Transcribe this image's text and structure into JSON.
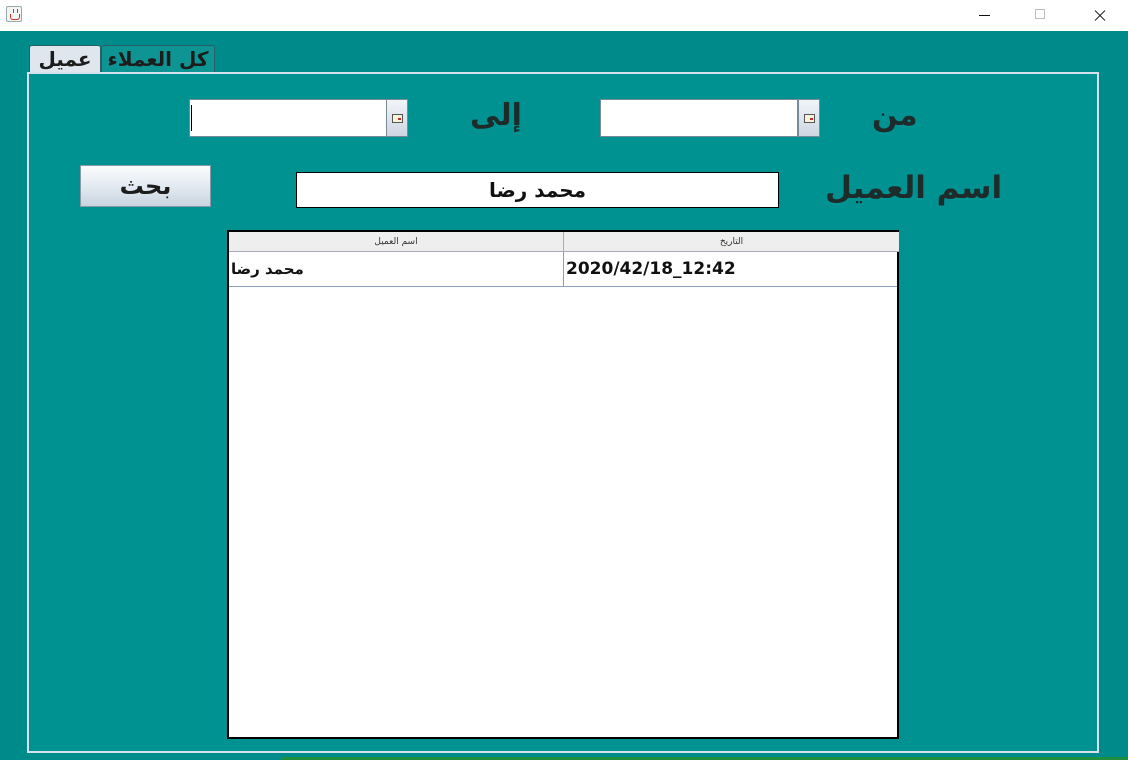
{
  "window": {
    "min_icon": "minimize-icon",
    "max_icon": "maximize-icon",
    "close_icon": "close-icon"
  },
  "tabs": [
    {
      "label": "عميل",
      "selected": true
    },
    {
      "label": "كل العملاء",
      "selected": false
    }
  ],
  "form": {
    "from_label": "من",
    "to_label": "إلى",
    "from_value": "",
    "to_value": "",
    "customer_name_label": "اسم العميل",
    "customer_name_value": "محمد رضا",
    "search_label": "بحث"
  },
  "table": {
    "columns": [
      "اسم العميل",
      "التاريخ"
    ],
    "rows": [
      {
        "customer": "محمد رضا",
        "date": "2020/42/18_12:42"
      }
    ]
  },
  "colors": {
    "background": "#007f7f",
    "panel": "#009191",
    "tab_selected": "#dfe6ee"
  }
}
